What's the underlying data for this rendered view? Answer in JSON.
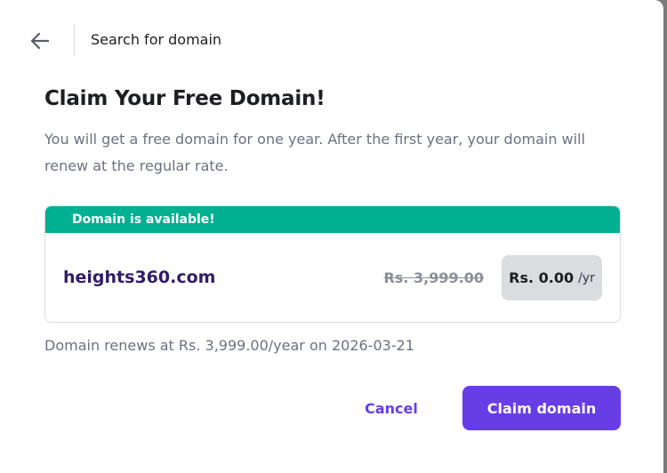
{
  "header": {
    "back_icon": "arrow-left-icon",
    "title": "Search for domain"
  },
  "main": {
    "heading": "Claim Your Free Domain!",
    "description": "You will get a free domain for one year. After the first year, your domain will renew at the regular rate."
  },
  "domain_card": {
    "status": "Domain is available!",
    "status_color": "#00b090",
    "domain": "heights360.com",
    "original_price": "Rs. 3,999.00",
    "price": "Rs. 0.00",
    "period": "/yr"
  },
  "renewal_note": "Domain renews at Rs. 3,999.00/year on 2026-03-21",
  "actions": {
    "cancel_label": "Cancel",
    "claim_label": "Claim domain",
    "accent_color": "#673de6"
  }
}
